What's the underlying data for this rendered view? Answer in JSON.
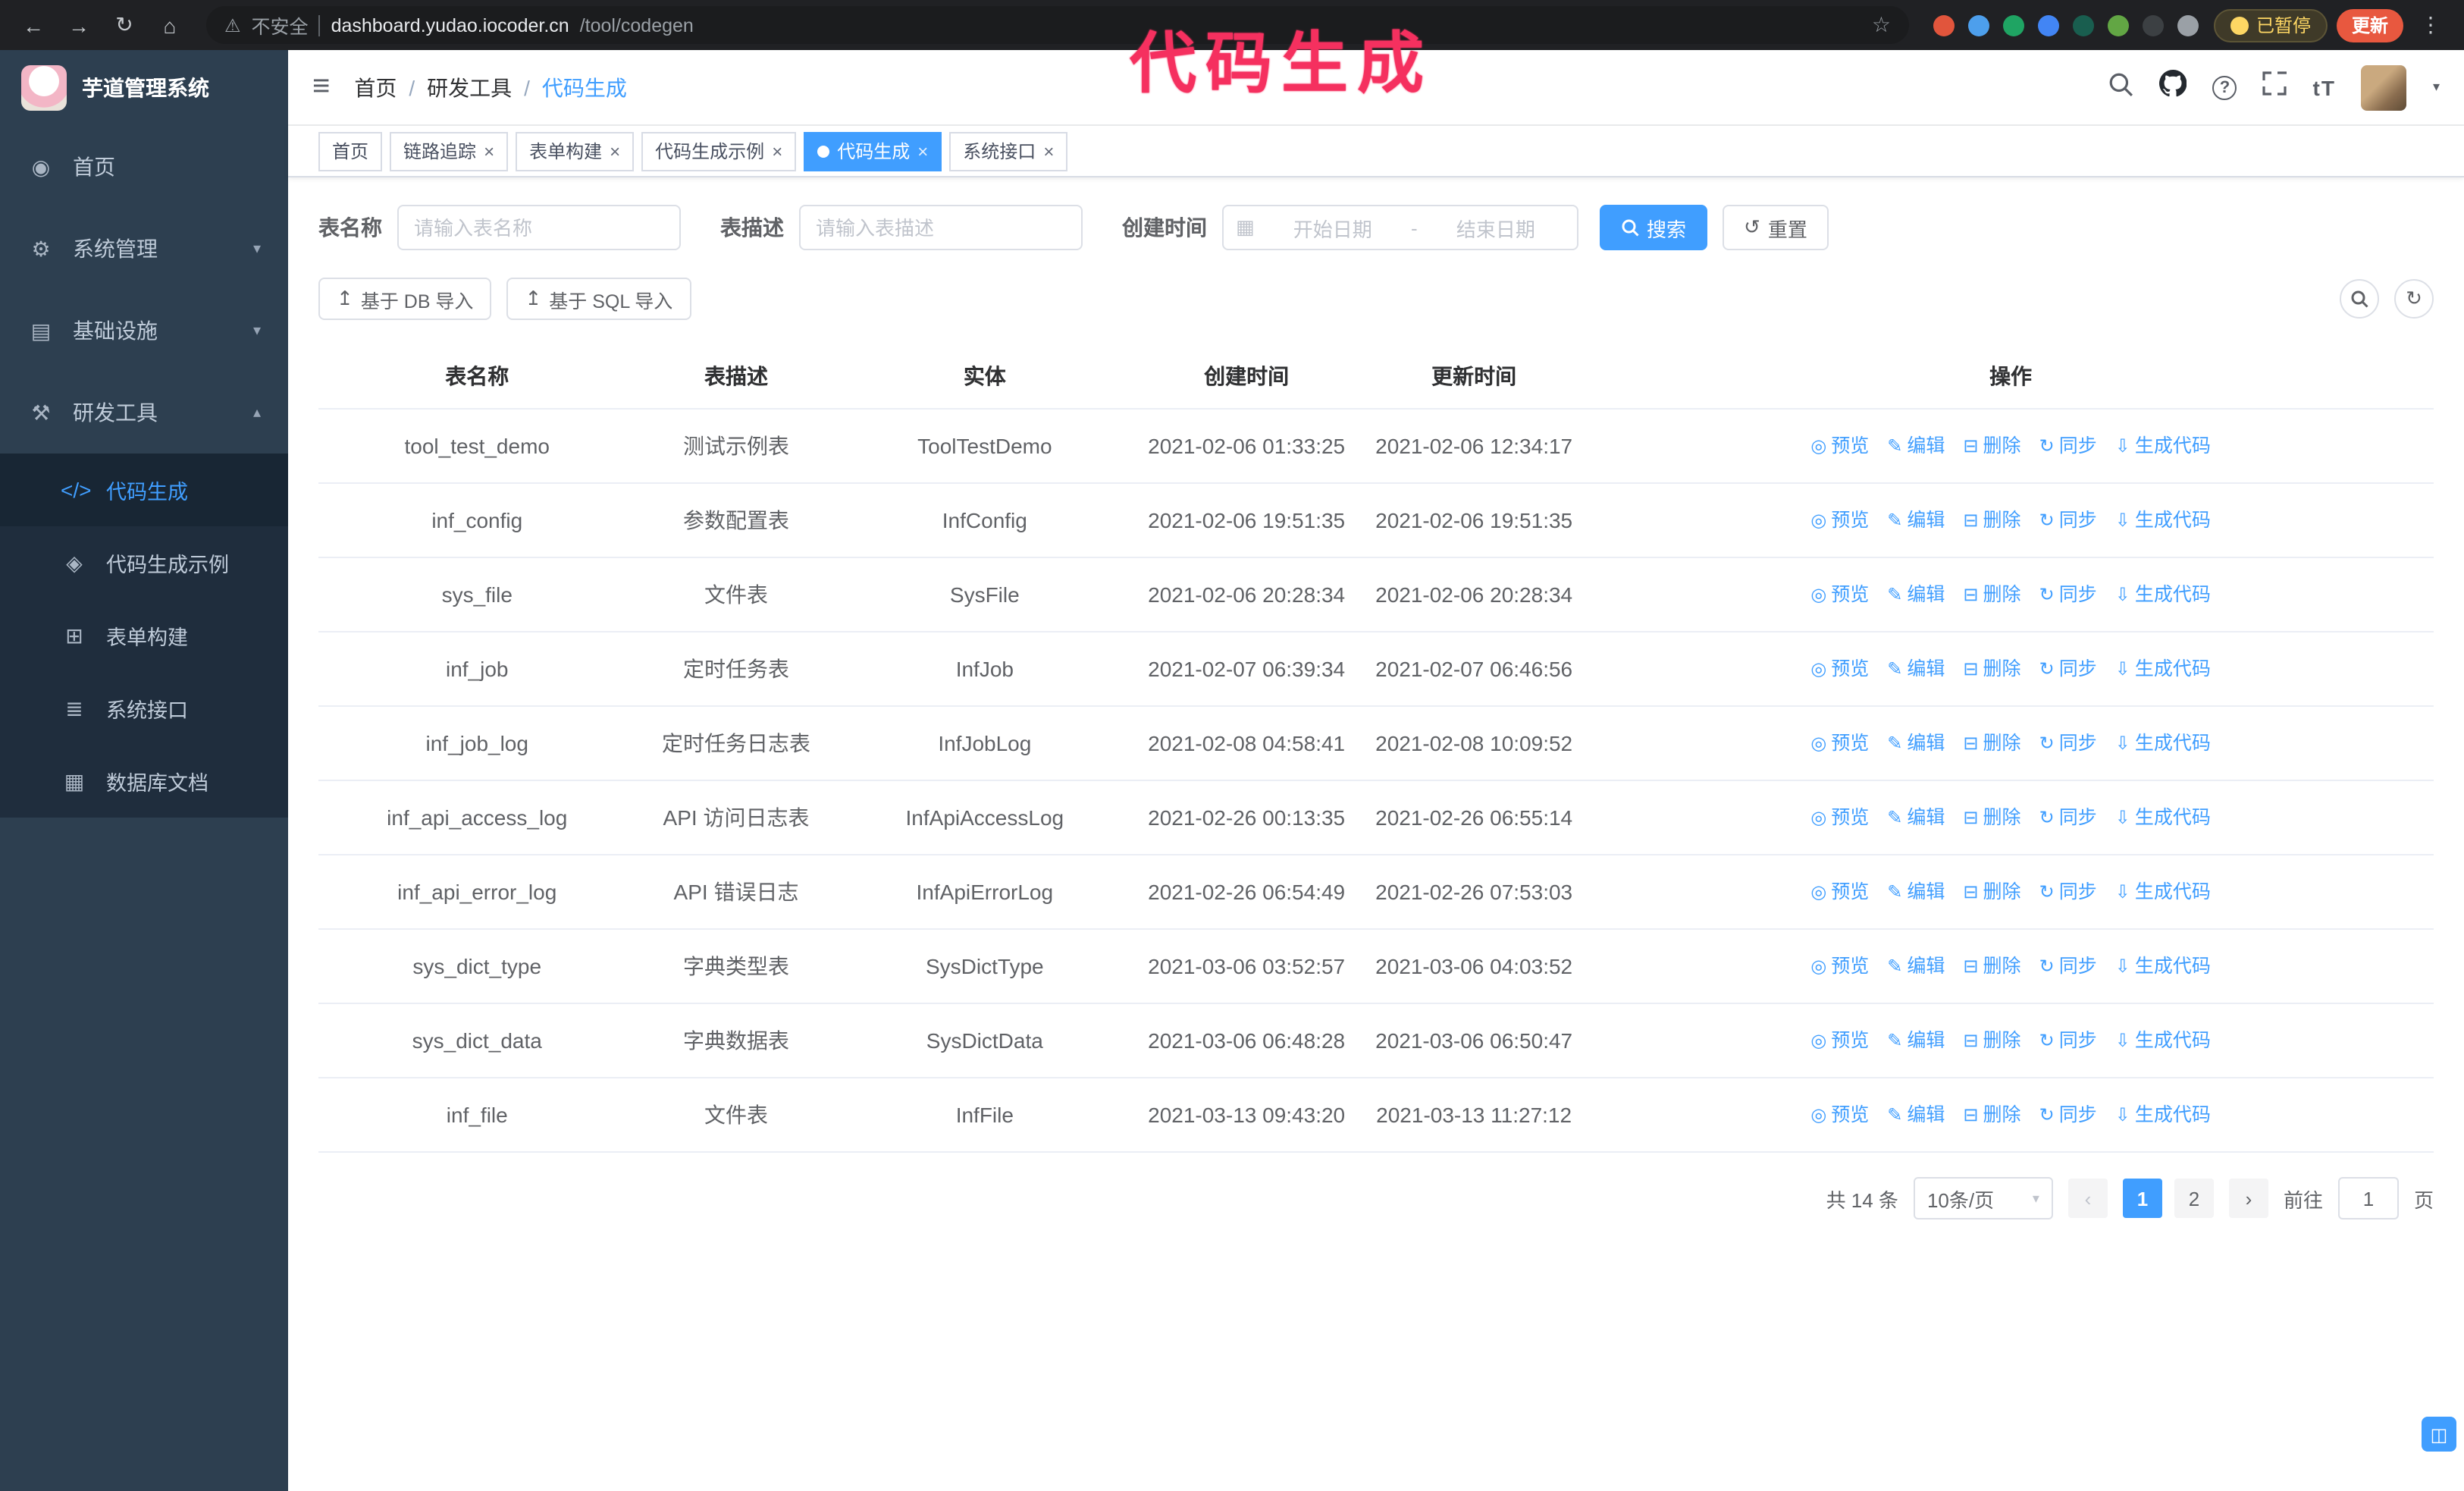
{
  "browser": {
    "warning": "不安全",
    "url_host": "dashboard.yudao.iocoder.cn",
    "url_path": "/tool/codegen",
    "paused": "已暂停",
    "update": "更新",
    "ext_colors": [
      "#e1553c",
      "#4d9fec",
      "#1fa463",
      "#4285f4",
      "#195e4f",
      "#62a644",
      "#3c4043",
      "#9aa0a6"
    ]
  },
  "annotation": {
    "text": "代码生成"
  },
  "colors": {
    "accent": "#409eff",
    "sidebar_bg": "#2d3f50",
    "submenu_bg": "#1f2d3d",
    "annotation": "#f5305f",
    "active_tab_bg": "#409eff",
    "update_button_bg": "#e8583f"
  },
  "sidebar": {
    "title": "芋道管理系统",
    "menu": [
      {
        "label": "首页",
        "icon": "dashboard-icon",
        "chevron": ""
      },
      {
        "label": "系统管理",
        "icon": "gear-icon",
        "chevron": "down"
      },
      {
        "label": "基础设施",
        "icon": "infra-icon",
        "chevron": "down"
      },
      {
        "label": "研发工具",
        "icon": "tools-icon",
        "chevron": "up"
      }
    ],
    "submenu": [
      {
        "label": "代码生成",
        "icon": "code-icon",
        "active": true
      },
      {
        "label": "代码生成示例",
        "icon": "example-icon"
      },
      {
        "label": "表单构建",
        "icon": "form-icon"
      },
      {
        "label": "系统接口",
        "icon": "api-icon"
      },
      {
        "label": "数据库文档",
        "icon": "dbdoc-icon"
      }
    ]
  },
  "breadcrumb": [
    "首页",
    "研发工具",
    "代码生成"
  ],
  "breadcrumb_separator": "/",
  "tabs": [
    {
      "label": "首页",
      "closable": false,
      "active": false
    },
    {
      "label": "链路追踪",
      "closable": true,
      "active": false
    },
    {
      "label": "表单构建",
      "closable": true,
      "active": false
    },
    {
      "label": "代码生成示例",
      "closable": true,
      "active": false
    },
    {
      "label": "代码生成",
      "closable": true,
      "active": true
    },
    {
      "label": "系统接口",
      "closable": true,
      "active": false
    }
  ],
  "filters": {
    "table_name_label": "表名称",
    "table_name_placeholder": "请输入表名称",
    "table_desc_label": "表描述",
    "table_desc_placeholder": "请输入表描述",
    "create_time_label": "创建时间",
    "date_start_placeholder": "开始日期",
    "date_separator": "-",
    "date_end_placeholder": "结束日期",
    "search_button": "搜索",
    "reset_button": "重置"
  },
  "toolbar": {
    "import_db": "基于 DB 导入",
    "import_sql": "基于 SQL 导入"
  },
  "table": {
    "columns": [
      "表名称",
      "表描述",
      "实体",
      "创建时间",
      "更新时间",
      "操作"
    ],
    "actions": [
      {
        "label": "预览",
        "icon": "eye-icon"
      },
      {
        "label": "编辑",
        "icon": "edit-icon"
      },
      {
        "label": "删除",
        "icon": "delete-icon"
      },
      {
        "label": "同步",
        "icon": "sync-icon"
      },
      {
        "label": "生成代码",
        "icon": "generate-icon"
      }
    ],
    "rows": [
      {
        "name": "tool_test_demo",
        "desc": "测试示例表",
        "entity": "ToolTestDemo",
        "created": "2021-02-06 01:33:25",
        "updated": "2021-02-06 12:34:17"
      },
      {
        "name": "inf_config",
        "desc": "参数配置表",
        "entity": "InfConfig",
        "created": "2021-02-06 19:51:35",
        "updated": "2021-02-06 19:51:35"
      },
      {
        "name": "sys_file",
        "desc": "文件表",
        "entity": "SysFile",
        "created": "2021-02-06 20:28:34",
        "updated": "2021-02-06 20:28:34"
      },
      {
        "name": "inf_job",
        "desc": "定时任务表",
        "entity": "InfJob",
        "created": "2021-02-07 06:39:34",
        "updated": "2021-02-07 06:46:56"
      },
      {
        "name": "inf_job_log",
        "desc": "定时任务日志表",
        "entity": "InfJobLog",
        "created": "2021-02-08 04:58:41",
        "updated": "2021-02-08 10:09:52"
      },
      {
        "name": "inf_api_access_log",
        "desc": "API 访问日志表",
        "entity": "InfApiAccessLog",
        "created": "2021-02-26 00:13:35",
        "updated": "2021-02-26 06:55:14"
      },
      {
        "name": "inf_api_error_log",
        "desc": "API 错误日志",
        "entity": "InfApiErrorLog",
        "created": "2021-02-26 06:54:49",
        "updated": "2021-02-26 07:53:03"
      },
      {
        "name": "sys_dict_type",
        "desc": "字典类型表",
        "entity": "SysDictType",
        "created": "2021-03-06 03:52:57",
        "updated": "2021-03-06 04:03:52"
      },
      {
        "name": "sys_dict_data",
        "desc": "字典数据表",
        "entity": "SysDictData",
        "created": "2021-03-06 06:48:28",
        "updated": "2021-03-06 06:50:47"
      },
      {
        "name": "inf_file",
        "desc": "文件表",
        "entity": "InfFile",
        "created": "2021-03-13 09:43:20",
        "updated": "2021-03-13 11:27:12"
      }
    ]
  },
  "pagination": {
    "total": "共 14 条",
    "page_size": "10条/页",
    "pages": [
      "1",
      "2"
    ],
    "active_page": "1",
    "goto_label": "前往",
    "goto_value": "1",
    "unit": "页"
  }
}
